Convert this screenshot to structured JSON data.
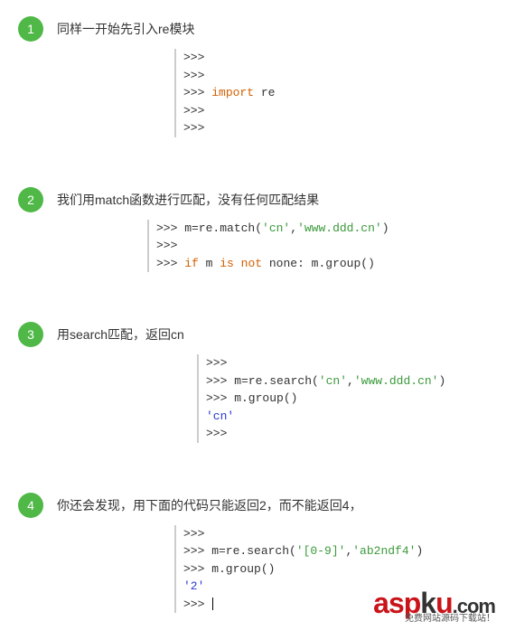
{
  "steps": [
    {
      "num": "1",
      "title": "同样一开始先引入re模块",
      "code_html": ">>><br>>>><br>>>> <span class='kw'>import</span> re<br>>>><br>>>>",
      "code_class": "code-1"
    },
    {
      "num": "2",
      "title": "我们用match函数进行匹配，没有任何匹配结果",
      "code_html": ">>> m=re.match(<span class='str'>'cn'</span>,<span class='str'>'www.ddd.cn'</span>)<br>>>><br>>>> <span class='kw'>if</span> m <span class='kw'>is</span> <span class='kw'>not</span> none: m.group()<br>",
      "code_class": "code-2"
    },
    {
      "num": "3",
      "title": "用search匹配，返回cn",
      "code_html": ">>><br>>>> m=re.search(<span class='str'>'cn'</span>,<span class='str'>'www.ddd.cn'</span>)<br>>>> m.group()<br><span class='blue'>'cn'</span><br>>>>",
      "code_class": "code-3"
    },
    {
      "num": "4",
      "title": "你还会发现，用下面的代码只能返回2，而不能返回4，",
      "code_html": ">>><br>>>> m=re.search(<span class='str'>'[0-9]'</span>,<span class='str'>'ab2ndf4'</span>)<br>>>> m.group()<br><span class='blue'>'2'</span><br>>>> <span class='cursor'></span>",
      "code_class": "code-4"
    }
  ],
  "watermark": {
    "brand_red": "asp",
    "brand_dark_k": "k",
    "brand_red_u": "u",
    "brand_com": ".com",
    "sub": "免费网站源码下载站！"
  }
}
